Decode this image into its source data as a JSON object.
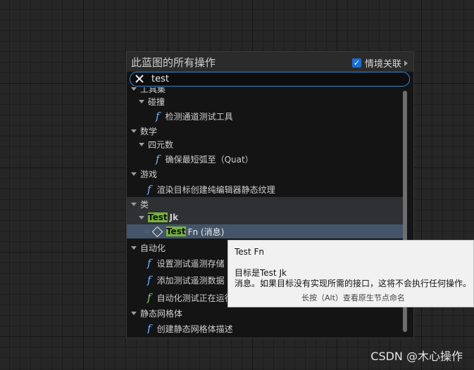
{
  "panel": {
    "title": "此蓝图的所有操作",
    "context_sensitive_label": "情境关联",
    "context_sensitive_checked": true
  },
  "search": {
    "value": "test",
    "clear_icon": "close-icon"
  },
  "tree": {
    "clipped_category": "工具集",
    "collision": "碰撞",
    "collision_fn": "检测通道测试工具",
    "math": "数学",
    "quaternion": "四元数",
    "quat_fn": "确保最短弧至（Quat）",
    "game": "游戏",
    "game_fn": "渲染目标创建纯编辑器静态纹理",
    "class": "类",
    "testjk_hl": "Test",
    "testjk_rest": "Jk",
    "testfn_hl": "Test",
    "testfn_rest": "Fn (消息)",
    "automation": "自动化",
    "auto_fn1": "设置测试遥测存储",
    "auto_fn2": "添加测试遥测数据",
    "auto_fn3": "自动化测试正在运行",
    "static_mesh": "静态网格体",
    "static_fn": "创建静态网格体描述"
  },
  "tooltip": {
    "title": "Test Fn",
    "line1": "目标是Test Jk",
    "line2": "消息。如果目标没有实现所需的接口，这将不会执行任何操作。",
    "hint": "长按（Alt）查看原生节点命名"
  },
  "watermark": "CSDN @木心操作",
  "colors": {
    "accent": "#2a8ad8",
    "highlight": "#77b33c",
    "function_icon": "#6fb2ff",
    "selected_row": "#445569"
  }
}
